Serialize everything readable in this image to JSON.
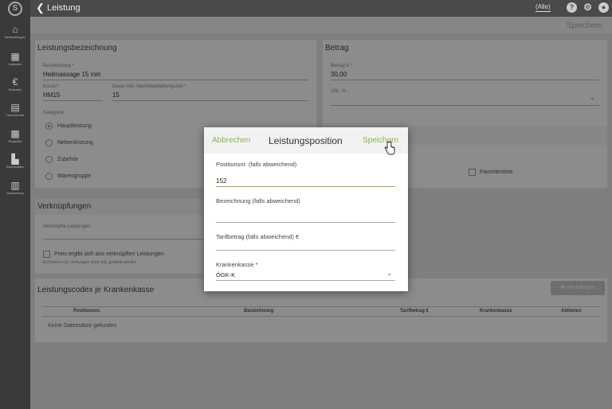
{
  "sidebar": {
    "logo": "S",
    "items": [
      {
        "icon": "home-icon",
        "glyph": "⌂",
        "label": "Behandlungen"
      },
      {
        "icon": "calendar-icon",
        "glyph": "▦",
        "label": "Kalender"
      },
      {
        "icon": "euro-icon",
        "glyph": "€",
        "label": "Finanzen"
      },
      {
        "icon": "document-icon",
        "glyph": "▤",
        "label": "Honorarnote"
      },
      {
        "icon": "qr-icon",
        "glyph": "▩",
        "label": "Registrier"
      },
      {
        "icon": "building-icon",
        "glyph": "▙",
        "label": "Stammdaten"
      },
      {
        "icon": "chart-icon",
        "glyph": "▥",
        "label": "Auswertung"
      }
    ]
  },
  "header": {
    "back_glyph": "❮",
    "title": "Leistung",
    "filter": "(Alle)",
    "help_glyph": "?",
    "settings_glyph": "⚙",
    "user_glyph": "●"
  },
  "subbar": {
    "save_label": "Speichern"
  },
  "bezeichnung_card": {
    "title": "Leistungsbezeichnung",
    "bezeichnung_label": "Bezeichnung *",
    "bezeichnung_value": "Heilmassage 15 min",
    "kuerzel_label": "Kürzel *",
    "kuerzel_value": "HM15",
    "dauer_label": "Dauer inkl. Nachbearbeitungszeit *",
    "dauer_value": "15",
    "kategorie_label": "Kategorie",
    "kategorien": [
      "Hauptleistung",
      "Nebenleistung",
      "Zubehör",
      "Warengruppe"
    ]
  },
  "betrag_card": {
    "title": "Betrag",
    "betrag_label": "Betrag € *",
    "betrag_value": "30,00",
    "ust_label": "USt. %",
    "checkbox_label": "Favoritenliste"
  },
  "verkn_card": {
    "title": "Verknüpfungen",
    "field_label": "Verknüpfte Leistungen",
    "checkbox_label": "Preis ergibt sich aus verknüpften Leistungen",
    "hint": "Es können nur Leistungen ohne Std. gewählt werden"
  },
  "codex_card": {
    "title": "Leistungscodex je Krankenkasse",
    "add_label": "Hinzufügen",
    "columns": [
      "Positionsnr.",
      "Bezeichnung",
      "Tarifbetrag €",
      "Krankenkasse",
      "Aktionen"
    ],
    "empty": "Keine Datensätze gefunden"
  },
  "modal": {
    "cancel": "Abbrechen",
    "title": "Leistungsposition",
    "save": "Speichern",
    "posnr_label": "Positionsnr. (falls abweichend)",
    "posnr_value": "152",
    "bez_label": "Bezeichnung (falls abweichend)",
    "bez_value": "",
    "tarif_label": "Tarifbetrag (falls abweichend) €",
    "tarif_value": "",
    "kasse_label": "Krankenkasse *",
    "kasse_value": "ÖGK-K"
  },
  "colors": {
    "accent": "#8ab34a",
    "sidebar": "#3a3a3a",
    "topbar": "#4a4a4a"
  }
}
